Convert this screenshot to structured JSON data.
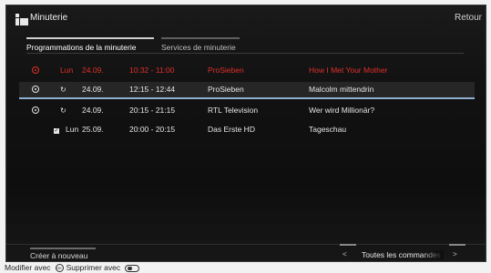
{
  "header": {
    "title": "Minuterie",
    "back_label": "Retour"
  },
  "tabs": [
    {
      "label": "Programmations de la minuterie",
      "active": true
    },
    {
      "label": "Services de minuterie",
      "active": false
    }
  ],
  "timers": [
    {
      "status_icon": "record-dot-icon",
      "type": "conflict",
      "day": "Lun",
      "date": "24.09.",
      "time": "10:32 - 11:00",
      "channel": "ProSieben",
      "program": "How I Met Your Mother"
    },
    {
      "status_icon": "record-dot-icon",
      "type": "series",
      "day": "",
      "date": "24.09.",
      "time": "12:15 - 12:44",
      "channel": "ProSieben",
      "program": "Malcolm mittendrin"
    },
    {
      "status_icon": "record-dot-icon",
      "type": "series",
      "day": "",
      "date": "24.09.",
      "time": "20:15 - 21:15",
      "channel": "RTL Television",
      "program": "Wer wird Millionär?"
    },
    {
      "status_icon": "",
      "type": "checked",
      "day": "Lun",
      "date": "25.09.",
      "time": "20:00 - 20:15",
      "channel": "Das Erste HD",
      "program": "Tageschau"
    }
  ],
  "footer": {
    "create_label": "Créer à nouveau",
    "nav_prev": "<",
    "nav_label": "Toutes les commandes",
    "nav_next": ">"
  },
  "hints": {
    "modify_label": "Modifier avec",
    "ok_glyph": "OK",
    "delete_label": "Supprimer avec"
  },
  "colors": {
    "conflict": "#e0302a",
    "selection_rule": "#8fb0d0"
  }
}
